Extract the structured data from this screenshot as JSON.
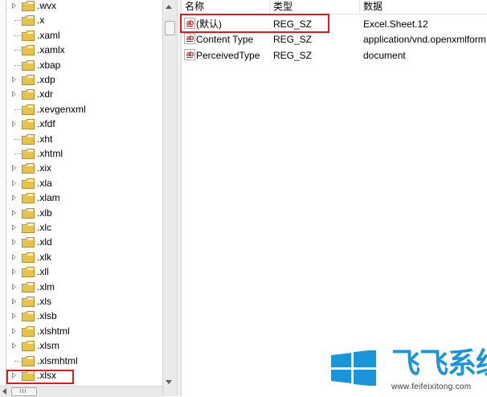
{
  "tree": {
    "items": [
      {
        "label": ".wvx",
        "expandable": true
      },
      {
        "label": ".x",
        "expandable": false
      },
      {
        "label": ".xaml",
        "expandable": false
      },
      {
        "label": ".xamlx",
        "expandable": false
      },
      {
        "label": ".xbap",
        "expandable": false
      },
      {
        "label": ".xdp",
        "expandable": true
      },
      {
        "label": ".xdr",
        "expandable": true
      },
      {
        "label": ".xevgenxml",
        "expandable": false
      },
      {
        "label": ".xfdf",
        "expandable": true
      },
      {
        "label": ".xht",
        "expandable": false
      },
      {
        "label": ".xhtml",
        "expandable": false
      },
      {
        "label": ".xix",
        "expandable": true
      },
      {
        "label": ".xla",
        "expandable": true
      },
      {
        "label": ".xlam",
        "expandable": true
      },
      {
        "label": ".xlb",
        "expandable": true
      },
      {
        "label": ".xlc",
        "expandable": true
      },
      {
        "label": ".xld",
        "expandable": true
      },
      {
        "label": ".xlk",
        "expandable": true
      },
      {
        "label": ".xll",
        "expandable": true
      },
      {
        "label": ".xlm",
        "expandable": true
      },
      {
        "label": ".xls",
        "expandable": true
      },
      {
        "label": ".xlsb",
        "expandable": true
      },
      {
        "label": ".xlshtml",
        "expandable": true
      },
      {
        "label": ".xlsm",
        "expandable": true
      },
      {
        "label": ".xlsmhtml",
        "expandable": false
      },
      {
        "label": ".xlsx",
        "expandable": true
      }
    ],
    "highlighted": ".xlsx"
  },
  "values": {
    "columns": {
      "name": "名称",
      "type": "类型",
      "data": "数据"
    },
    "rows": [
      {
        "icon": "string-value-icon",
        "name": "(默认)",
        "type": "REG_SZ",
        "data": "Excel.Sheet.12"
      },
      {
        "icon": "string-value-icon",
        "name": "Content Type",
        "type": "REG_SZ",
        "data": "application/vnd.openxmlform"
      },
      {
        "icon": "string-value-icon",
        "name": "PerceivedType",
        "type": "REG_SZ",
        "data": "document"
      }
    ],
    "icon_label": "ab"
  },
  "watermark": {
    "text": "飞飞系统",
    "url": "www.feifeixitong.com",
    "color": "#1a95dc"
  },
  "colors": {
    "highlight": "#e01b1b",
    "folder": "#e8c34a"
  }
}
